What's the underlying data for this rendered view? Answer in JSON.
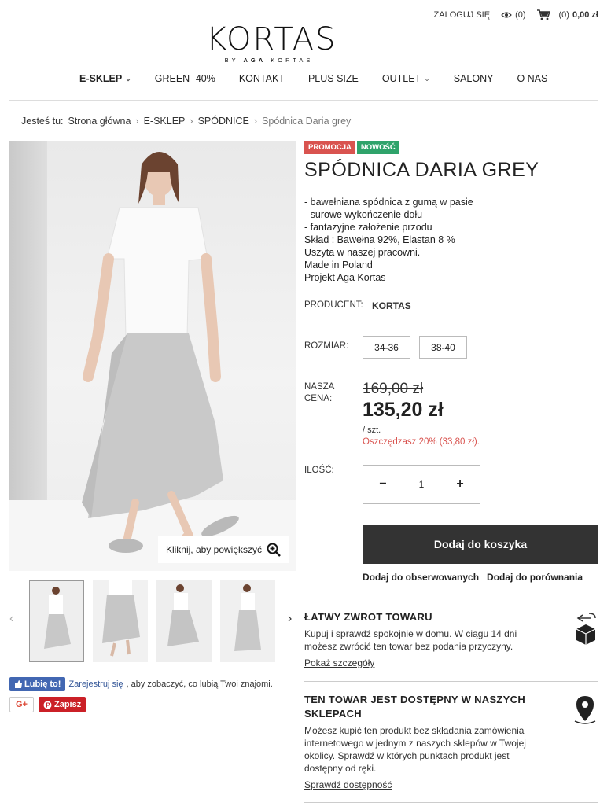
{
  "topbar": {
    "login": "ZALOGUJ SIĘ",
    "watched": "(0)",
    "cart_count": "(0)",
    "cart_total": "0,00 zł"
  },
  "logo": {
    "brand": "KORTAS",
    "sub_pre": "BY ",
    "sub_bold": "AGA",
    "sub_post": " KORTAS"
  },
  "nav": [
    {
      "label": "E-SKLEP",
      "bold": true,
      "chevron": true
    },
    {
      "label": "GREEN -40%"
    },
    {
      "label": "KONTAKT"
    },
    {
      "label": "PLUS SIZE"
    },
    {
      "label": "OUTLET",
      "chevron": true
    },
    {
      "label": "SALONY"
    },
    {
      "label": "O NAS"
    }
  ],
  "breadcrumb": {
    "prefix": "Jesteś tu:",
    "items": [
      "Strona główna",
      "E-SKLEP",
      "SPÓDNICE"
    ],
    "current": "Spódnica Daria grey"
  },
  "gallery": {
    "zoom_text": "Kliknij, aby powiększyć"
  },
  "social": {
    "like": "Lubię to!",
    "register": "Zarejestruj się",
    "like_text": ", aby zobaczyć, co lubią Twoi znajomi.",
    "gplus": "G+",
    "pin": "Zapisz"
  },
  "product": {
    "badge_promo": "PROMOCJA",
    "badge_new": "NOWOŚĆ",
    "title": "SPÓDNICA DARIA GREY",
    "description": [
      "- bawełniana spódnica z gumą w pasie",
      "- surowe wykończenie dołu",
      "- fantazyjne założenie przodu",
      "Skład : Bawełna 92%, Elastan 8 %",
      "Uszyta w naszej pracowni.",
      "Made in Poland",
      "Projekt Aga Kortas"
    ],
    "producer_label": "PRODUCENT:",
    "producer": "KORTAS",
    "size_label": "ROZMIAR:",
    "sizes": [
      "34-36",
      "38-40"
    ],
    "price_label_1": "NASZA",
    "price_label_2": "CENA:",
    "old_price": "169,00 zł",
    "new_price": "135,20 zł",
    "per_unit": "/ szt.",
    "savings": "Oszczędzasz 20% (33,80 zł).",
    "qty_label": "ILOŚĆ:",
    "qty_minus": "−",
    "qty": "1",
    "qty_plus": "+",
    "add_to_cart": "Dodaj do koszyka",
    "watch": "Dodaj do obserwowanych",
    "compare": "Dodaj do porównania"
  },
  "return_info": {
    "title": "ŁATWY ZWROT TOWARU",
    "text": "Kupuj i sprawdź spokojnie w domu. W ciągu 14 dni możesz zwrócić ten towar bez podania przyczyny.",
    "link": "Pokaż szczegóły"
  },
  "store_info": {
    "title": "TEN TOWAR JEST DOSTĘPNY W NASZYCH SKLEPACH",
    "text": "Możesz kupić ten produkt bez składania zamówienia internetowego w jednym z naszych sklepów w Twojej okolicy. Sprawdź w których punktach produkt jest dostępny od ręki.",
    "link": "Sprawdź dostępność"
  },
  "colors": {
    "accent_dark": "#333333",
    "promo": "#d9534f",
    "new": "#2fa36b",
    "fb": "#4267b2",
    "pin": "#cb2027"
  }
}
